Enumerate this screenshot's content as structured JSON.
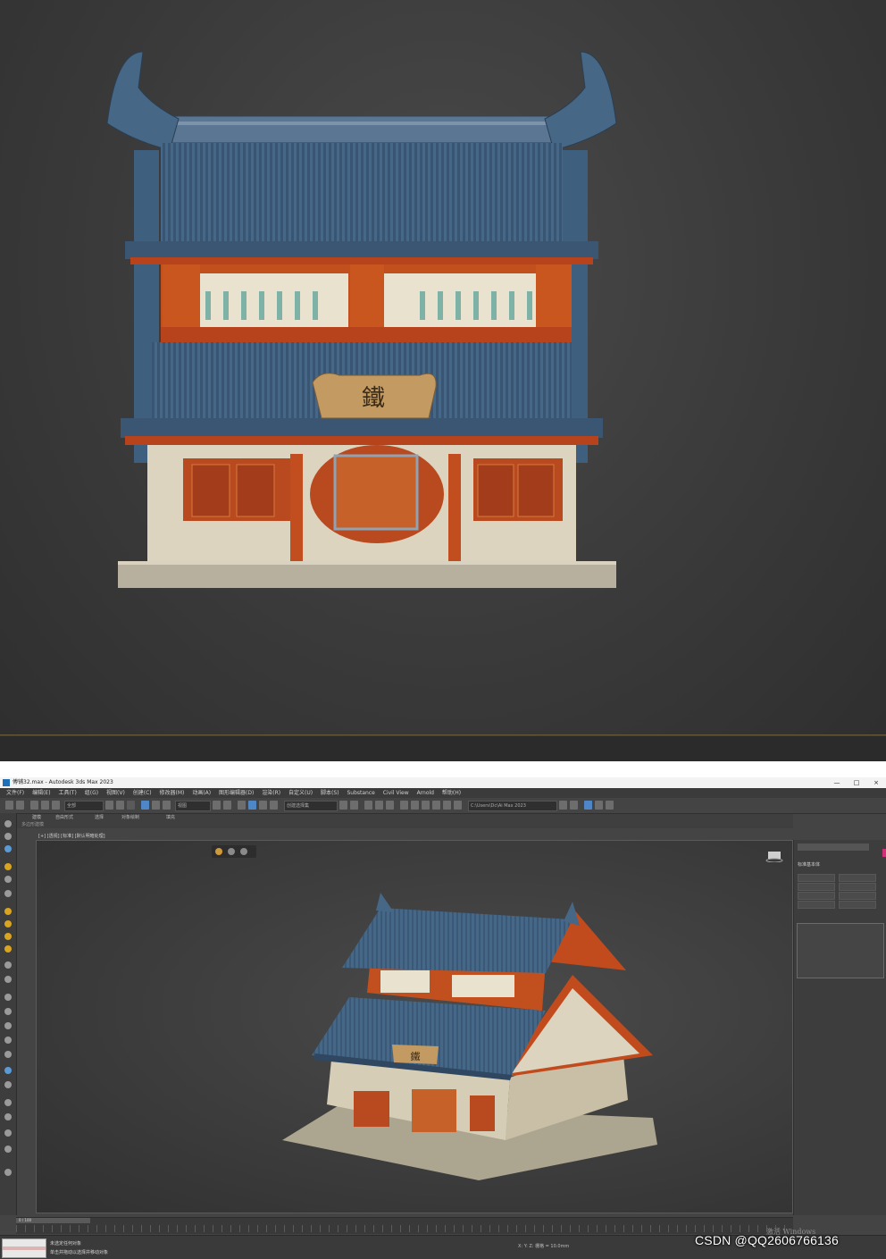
{
  "top_render": {
    "signboard_char": "鐵"
  },
  "window": {
    "title": "傅铺32.max - Autodesk 3ds Max 2023",
    "controls": [
      "—",
      "□",
      "×"
    ]
  },
  "menu": {
    "items": [
      "文件(F)",
      "编辑(E)",
      "工具(T)",
      "组(G)",
      "视图(V)",
      "创建(C)",
      "修改器(M)",
      "动画(A)",
      "图形编辑器(D)",
      "渲染(R)",
      "自定义(U)",
      "脚本(S)",
      "Substance",
      "Civil View",
      "Arnold",
      "帮助(H)"
    ]
  },
  "toolbar": {
    "selection_filter": "全部",
    "view_dropdown": "视图",
    "named_set": "创建选择集",
    "workspace": "C:\\Users\\Dc\\Ai Max 2023"
  },
  "ribbon": {
    "tabs": [
      "建模",
      "自由形式",
      "选择",
      "对象绘制",
      "填充"
    ],
    "sub_label": "多边形建模"
  },
  "viewport": {
    "label": "[+] [透视] [标准] [默认明暗处理]",
    "signboard_char": "鐵"
  },
  "right_panel": {
    "header": "标准基本体"
  },
  "timeline": {
    "frame_label": "0 / 100"
  },
  "status": {
    "line1": "未选定任何对象",
    "line2": "单击并拖动以选择并移动对象",
    "coords": "X:   Y:   Z:   栅格 = 10.0mm",
    "activate": "激活 Windows"
  },
  "watermark": "CSDN @QQ2606766136"
}
